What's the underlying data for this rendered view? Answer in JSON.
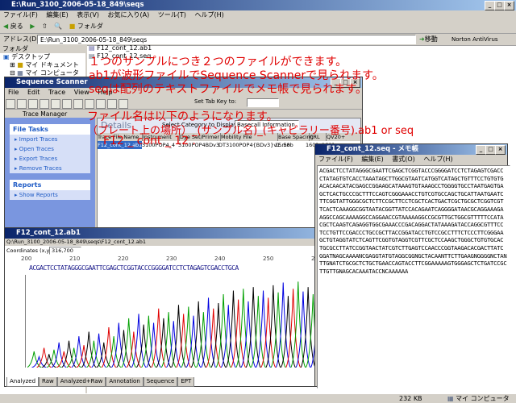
{
  "explorer": {
    "title": "E:\\Run_3100_2006-05-18_849\\seqs",
    "menu": [
      "ファイル(F)",
      "編集(E)",
      "表示(V)",
      "お気に入り(A)",
      "ツール(T)",
      "ヘルプ(H)"
    ],
    "toolbar": {
      "back": "戻る",
      "folders": "フォルダ"
    },
    "address_label": "アドレス(D)",
    "address_value": "E:\\Run_3100_2006-05-18_849\\seqs",
    "go_label": "移動",
    "norton_label": "Norton AntiVirus",
    "folder_pane_title": "フォルダ",
    "tree": [
      "デスクトップ",
      "マイ ドキュメント",
      "マイ コンピュータ"
    ],
    "files": [
      "F12_cont_12.ab1",
      "F12_cont_12.seq"
    ],
    "status_size": "232 KB",
    "status_location": "マイ コンピュータ"
  },
  "annotation": {
    "line1": "１つのサンプルにつき２つのファイルができます。",
    "line2": "ab1が波形ファイルでSequence Scannerで見られます。",
    "line3": "seqは配列のテキストファイルでメモ帳で見られます。",
    "line4": "ファイル名は以下のようになります。",
    "line5": "（プレート上の場所）_(サンプル名)_(キャピラリー番号).ab1 or seq",
    "line6": "F12 _ cont _ 12 ."
  },
  "scanner": {
    "title": "Sequence Scanner",
    "menu": [
      "File",
      "Edit",
      "Trace",
      "View",
      "Help"
    ],
    "trace_manager_tab": "Trace Manager",
    "sort_label": "Set Tab Key to:",
    "details_label": "Details",
    "select_category": "Select Category to Display:",
    "category_value": "Basecall Information",
    "file_tasks": "File Tasks",
    "tasks": [
      "Import Traces",
      "Open Traces",
      "Export Traces",
      "Remove Traces"
    ],
    "reports": "Reports",
    "report_links": [
      "Show Reports"
    ],
    "columns": [
      "Trace File Name",
      "Instrument",
      "Dye Set/Primer",
      "Mobility File",
      "Base Spacing",
      "CRL",
      "QV20+"
    ],
    "rows": [
      [
        "F12_cont_12.ab1",
        "3100POP4_4",
        "3100POP4BDv3",
        "DT3100POP4{BDv3}v1.mob",
        "15.58",
        "1601",
        "1601"
      ]
    ]
  },
  "trace_window": {
    "title": "F12_cont_12.ab1",
    "path": "Q:\\Run_3100_2006-05-18_849\\seqs\\F12_cont_12.ab1",
    "coord_label": "Coordinates (x,y)",
    "coord_value": "316,700",
    "ruler": [
      "200",
      "210",
      "220",
      "230",
      "240",
      "250",
      "260"
    ],
    "sequence": "ACGACTCCTATAGGGCGAATTCGAGCTCGGTACCCGGGGATCCTCTAGAGTCGACCTGCA",
    "tabs": [
      "Analyzed",
      "Raw",
      "Analyzed+Raw",
      "Annotation",
      "Sequence",
      "EPT"
    ]
  },
  "notepad": {
    "title": "F12_cont_12.seq - メモ帳",
    "menu": [
      "ファイル(F)",
      "編集(E)",
      "書式(O)",
      "ヘルプ(H)"
    ],
    "lines": [
      "ACGACTCCTATAGGGCGAATTCGAGCTCGGTACCCGGGGATCCTCTAGAGTCGACC",
      "CTATAGTGTCACCTAAATAGCTTGGCGTAATCATGGTCATAGCTGTTTCCTGTGTG",
      "ACACAACATACGAGCCGGAAGCATAAAGTGTAAAGCCTGGGGTGCCTAATGAGTGA",
      "GCTCACTGCCCGCTTTCCAGTCGGGAAACCTGTCGTGCCAGCTGCATTAATGAATC",
      "TTCGGTATTGGGCGCTCTTCCGCTTCCTCGCTCACTGACTCGCTGCGCTCGGTCGT",
      "TCACTCAAAGGCGGTAATACGGTTATCCACAGAATCAGGGGATAACGCAGGAAAGA",
      "AGGCCAGCAAAAGGCCAGGAACCGTAAAAAGGCCGCGTTGCTGGCGTTTTTCCATA",
      "CGCTCAAGTCAGAGGTGGCGAAACCCGACAGGACTATAAAGATACCAGGCGTTTCC",
      "TCCTGTTCCGACCCTGCCGCTTACCGGATACCTGTCCGCCTTTCTCCCTTCGGGAA",
      "GCTGTAGGTATCTCAGTTCGGTGTAGGTCGTTCGCTCCAAGCTGGGCTGTGTGCAC",
      "TGCGCCTTATCCGGTAACTATCGTCTTGAGTCCAACCCGGTAAGACACGACTTATC",
      "GGATNAGCAAAANCGAGGTATGTAGGCGGNGCTACAANTTCTTGAAGNGGGGNCTAN",
      "TTGNATCTGCGCTCTGCTGAACCAGTACCTTCGGAAAAAGTGGGAGCTCTGATCCGC",
      "TTGTTGNAGCACAAATACCNCAAAAAA"
    ]
  },
  "chromatogram": {
    "peaks": [
      [
        0.02,
        0.18,
        "g"
      ],
      [
        0.035,
        0.12,
        "b"
      ],
      [
        0.05,
        0.22,
        "r"
      ],
      [
        0.065,
        0.15,
        "k"
      ],
      [
        0.08,
        0.2,
        "g"
      ],
      [
        0.095,
        0.28,
        "b"
      ],
      [
        0.11,
        0.18,
        "r"
      ],
      [
        0.125,
        0.3,
        "k"
      ],
      [
        0.14,
        0.22,
        "g"
      ],
      [
        0.155,
        0.35,
        "b"
      ],
      [
        0.17,
        0.25,
        "r"
      ],
      [
        0.185,
        0.4,
        "k"
      ],
      [
        0.2,
        0.3,
        "g"
      ],
      [
        0.215,
        0.38,
        "b"
      ],
      [
        0.23,
        0.28,
        "k"
      ],
      [
        0.245,
        0.45,
        "r"
      ],
      [
        0.26,
        0.35,
        "g"
      ],
      [
        0.275,
        0.5,
        "b"
      ],
      [
        0.29,
        0.42,
        "k"
      ],
      [
        0.305,
        0.55,
        "g"
      ],
      [
        0.32,
        0.4,
        "r"
      ],
      [
        0.335,
        0.6,
        "b"
      ],
      [
        0.35,
        0.48,
        "k"
      ],
      [
        0.365,
        0.58,
        "g"
      ],
      [
        0.38,
        0.5,
        "b"
      ],
      [
        0.395,
        0.66,
        "r"
      ],
      [
        0.41,
        0.55,
        "k"
      ],
      [
        0.425,
        0.62,
        "g"
      ],
      [
        0.44,
        0.52,
        "b"
      ],
      [
        0.455,
        0.7,
        "k"
      ],
      [
        0.47,
        0.6,
        "r"
      ],
      [
        0.485,
        0.68,
        "g"
      ],
      [
        0.5,
        0.58,
        "b"
      ],
      [
        0.515,
        0.74,
        "k"
      ],
      [
        0.53,
        0.62,
        "g"
      ],
      [
        0.545,
        0.78,
        "b"
      ],
      [
        0.56,
        0.66,
        "r"
      ],
      [
        0.575,
        0.72,
        "k"
      ],
      [
        0.59,
        0.82,
        "g"
      ],
      [
        0.605,
        0.7,
        "b"
      ],
      [
        0.62,
        0.86,
        "k"
      ],
      [
        0.635,
        0.76,
        "r"
      ],
      [
        0.65,
        0.88,
        "g"
      ],
      [
        0.665,
        0.74,
        "b"
      ],
      [
        0.68,
        0.9,
        "k"
      ],
      [
        0.695,
        0.8,
        "g"
      ],
      [
        0.71,
        0.86,
        "b"
      ],
      [
        0.725,
        0.78,
        "r"
      ],
      [
        0.74,
        0.92,
        "k"
      ],
      [
        0.755,
        0.84,
        "g"
      ],
      [
        0.77,
        0.95,
        "b"
      ],
      [
        0.785,
        0.8,
        "k"
      ],
      [
        0.8,
        0.88,
        "r"
      ],
      [
        0.815,
        0.96,
        "g"
      ],
      [
        0.83,
        0.85,
        "b"
      ],
      [
        0.845,
        0.9,
        "k"
      ],
      [
        0.86,
        0.82,
        "g"
      ],
      [
        0.875,
        0.93,
        "b"
      ],
      [
        0.89,
        0.78,
        "r"
      ],
      [
        0.905,
        0.88,
        "k"
      ],
      [
        0.92,
        0.8,
        "g"
      ],
      [
        0.935,
        0.9,
        "b"
      ],
      [
        0.95,
        0.75,
        "k"
      ],
      [
        0.965,
        0.85,
        "g"
      ],
      [
        0.98,
        0.7,
        "b"
      ]
    ],
    "colors": {
      "g": "#00a000",
      "b": "#0000e0",
      "r": "#e00000",
      "k": "#000000"
    }
  }
}
